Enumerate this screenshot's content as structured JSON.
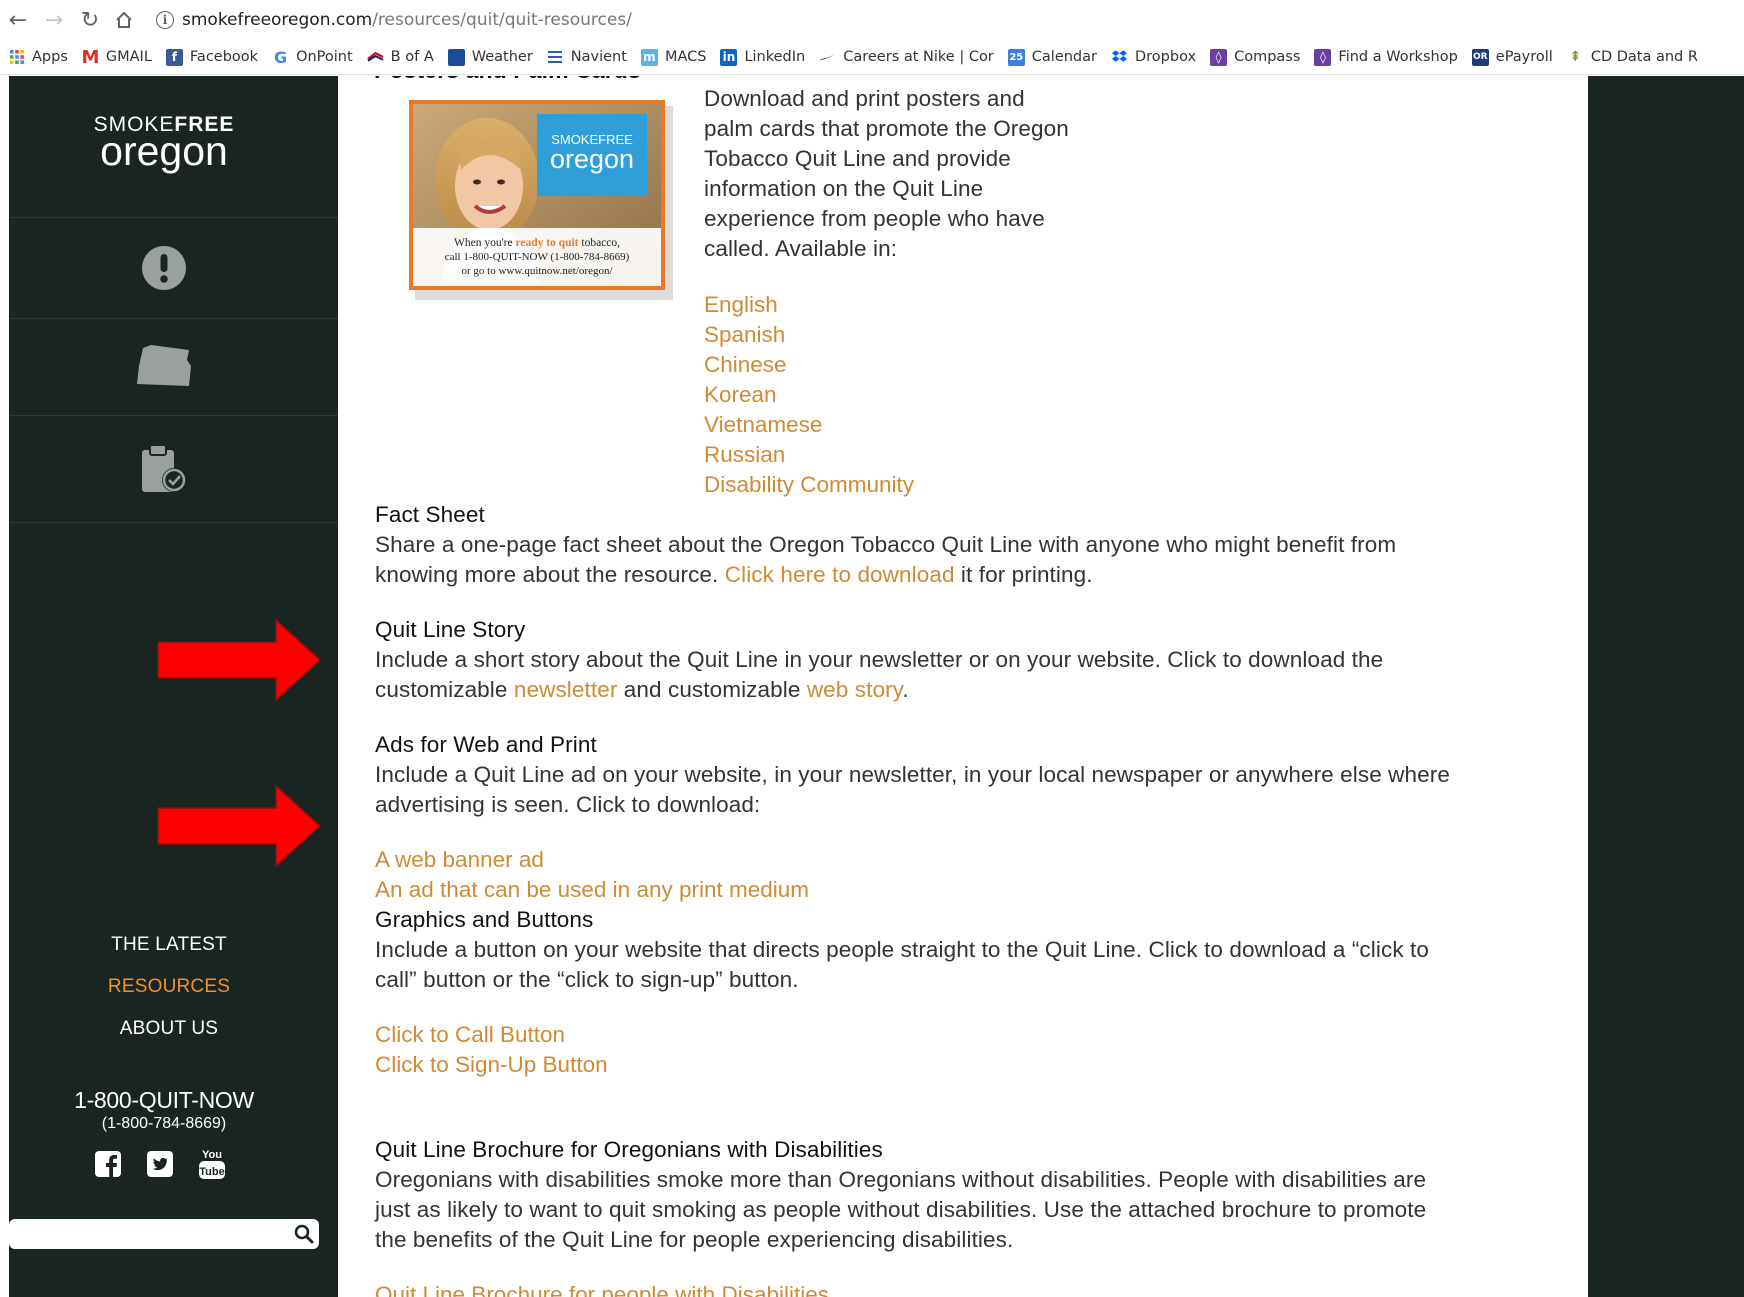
{
  "browser": {
    "url_domain": "smokefreeoregon.com",
    "url_path": "/resources/quit/quit-resources/",
    "bookmarks": [
      {
        "label": "Apps",
        "icon": "apps-grid-icon"
      },
      {
        "label": "GMAIL",
        "icon": "gmail-icon"
      },
      {
        "label": "Facebook",
        "icon": "facebook-icon"
      },
      {
        "label": "OnPoint",
        "icon": "google-icon"
      },
      {
        "label": "B of A",
        "icon": "bofa-icon"
      },
      {
        "label": "Weather",
        "icon": "weather-icon"
      },
      {
        "label": "Navient",
        "icon": "navient-icon"
      },
      {
        "label": "MACS",
        "icon": "macs-icon"
      },
      {
        "label": "LinkedIn",
        "icon": "linkedin-icon"
      },
      {
        "label": "Careers at Nike | Cor",
        "icon": "nike-icon"
      },
      {
        "label": "Calendar",
        "icon": "calendar-icon"
      },
      {
        "label": "Dropbox",
        "icon": "dropbox-icon"
      },
      {
        "label": "Compass",
        "icon": "compass-icon"
      },
      {
        "label": "Find a Workshop",
        "icon": "workshop-icon"
      },
      {
        "label": "ePayroll",
        "icon": "epayroll-icon"
      },
      {
        "label": "CD Data and R",
        "icon": "cd-data-icon"
      }
    ]
  },
  "sidebar": {
    "logo_top_light": "SMOKE",
    "logo_top_bold": "FREE",
    "logo_bottom": "oregon",
    "menu": [
      {
        "label": "THE LATEST",
        "active": false
      },
      {
        "label": "RESOURCES",
        "active": true
      },
      {
        "label": "ABOUT US",
        "active": false
      }
    ],
    "phone": "1-800-QUIT-NOW",
    "phone_number": "(1-800-784-8669)",
    "search_placeholder": ""
  },
  "content": {
    "poster_section_title": "Posters and Palm Cards",
    "poster": {
      "logo_top": "SMOKEFREE",
      "logo_bottom": "oregon",
      "caption_1a": "When you're ",
      "caption_1b": "ready to quit",
      "caption_1c": " tobacco,",
      "caption_2": "call 1-800-QUIT-NOW (1-800-784-8669)",
      "caption_3": "or go to www.quitnow.net/oregon/"
    },
    "poster_desc": [
      "Download and print posters and",
      "palm cards that promote the Oregon",
      "Tobacco Quit Line and provide",
      "information on the Quit Line",
      "experience from people who have",
      "called. Available in:"
    ],
    "languages": [
      "English",
      "Spanish",
      "Chinese",
      "Korean",
      "Vietnamese",
      "Russian",
      "Disability Community"
    ],
    "fact_sheet": {
      "title": "Fact Sheet",
      "line1": "Share a one-page fact sheet about the Oregon Tobacco Quit Line with anyone who might benefit from",
      "line2_a": "knowing more about the resource. ",
      "line2_link": "Click here to download",
      "line2_b": " it for printing."
    },
    "story": {
      "title": "Quit Line Story",
      "line1": "Include a short story about the Quit Line in your newsletter or on your website. Click to download the",
      "line2_a": "customizable ",
      "line2_link1": "newsletter",
      "line2_b": " and customizable ",
      "line2_link2": "web story",
      "line2_c": "."
    },
    "ads": {
      "title": "Ads for Web and Print",
      "line1": "Include a Quit Line ad on your website, in your newsletter, in your local newspaper or anywhere else where",
      "line2": "advertising is seen. Click to download:",
      "links": [
        "A web banner ad",
        "An ad that can be used in any print medium"
      ]
    },
    "graphics": {
      "title": "Graphics and Buttons",
      "line1": "Include a button on your website that directs people straight to the Quit Line. Click to download a “click to",
      "line2": "call” button or the “click to sign-up” button.",
      "links": [
        "Click to Call Button",
        "Click to Sign-Up Button"
      ]
    },
    "brochure": {
      "title": "Quit Line Brochure for Oregonians with Disabilities",
      "line1": "Oregonians with disabilities smoke more than Oregonians without disabilities. People with disabilities are",
      "line2": "just as likely to want to quit smoking as people without disabilities. Use the attached brochure to promote",
      "line3": "the benefits of the Quit Line for people experiencing disabilities.",
      "link": "Quit Line Brochure for people with Disabilities"
    }
  },
  "colors": {
    "sidebar_bg": "#1a2521",
    "link": "#cf8b34",
    "active_menu": "#f0922b",
    "arrow": "#ff0000"
  }
}
